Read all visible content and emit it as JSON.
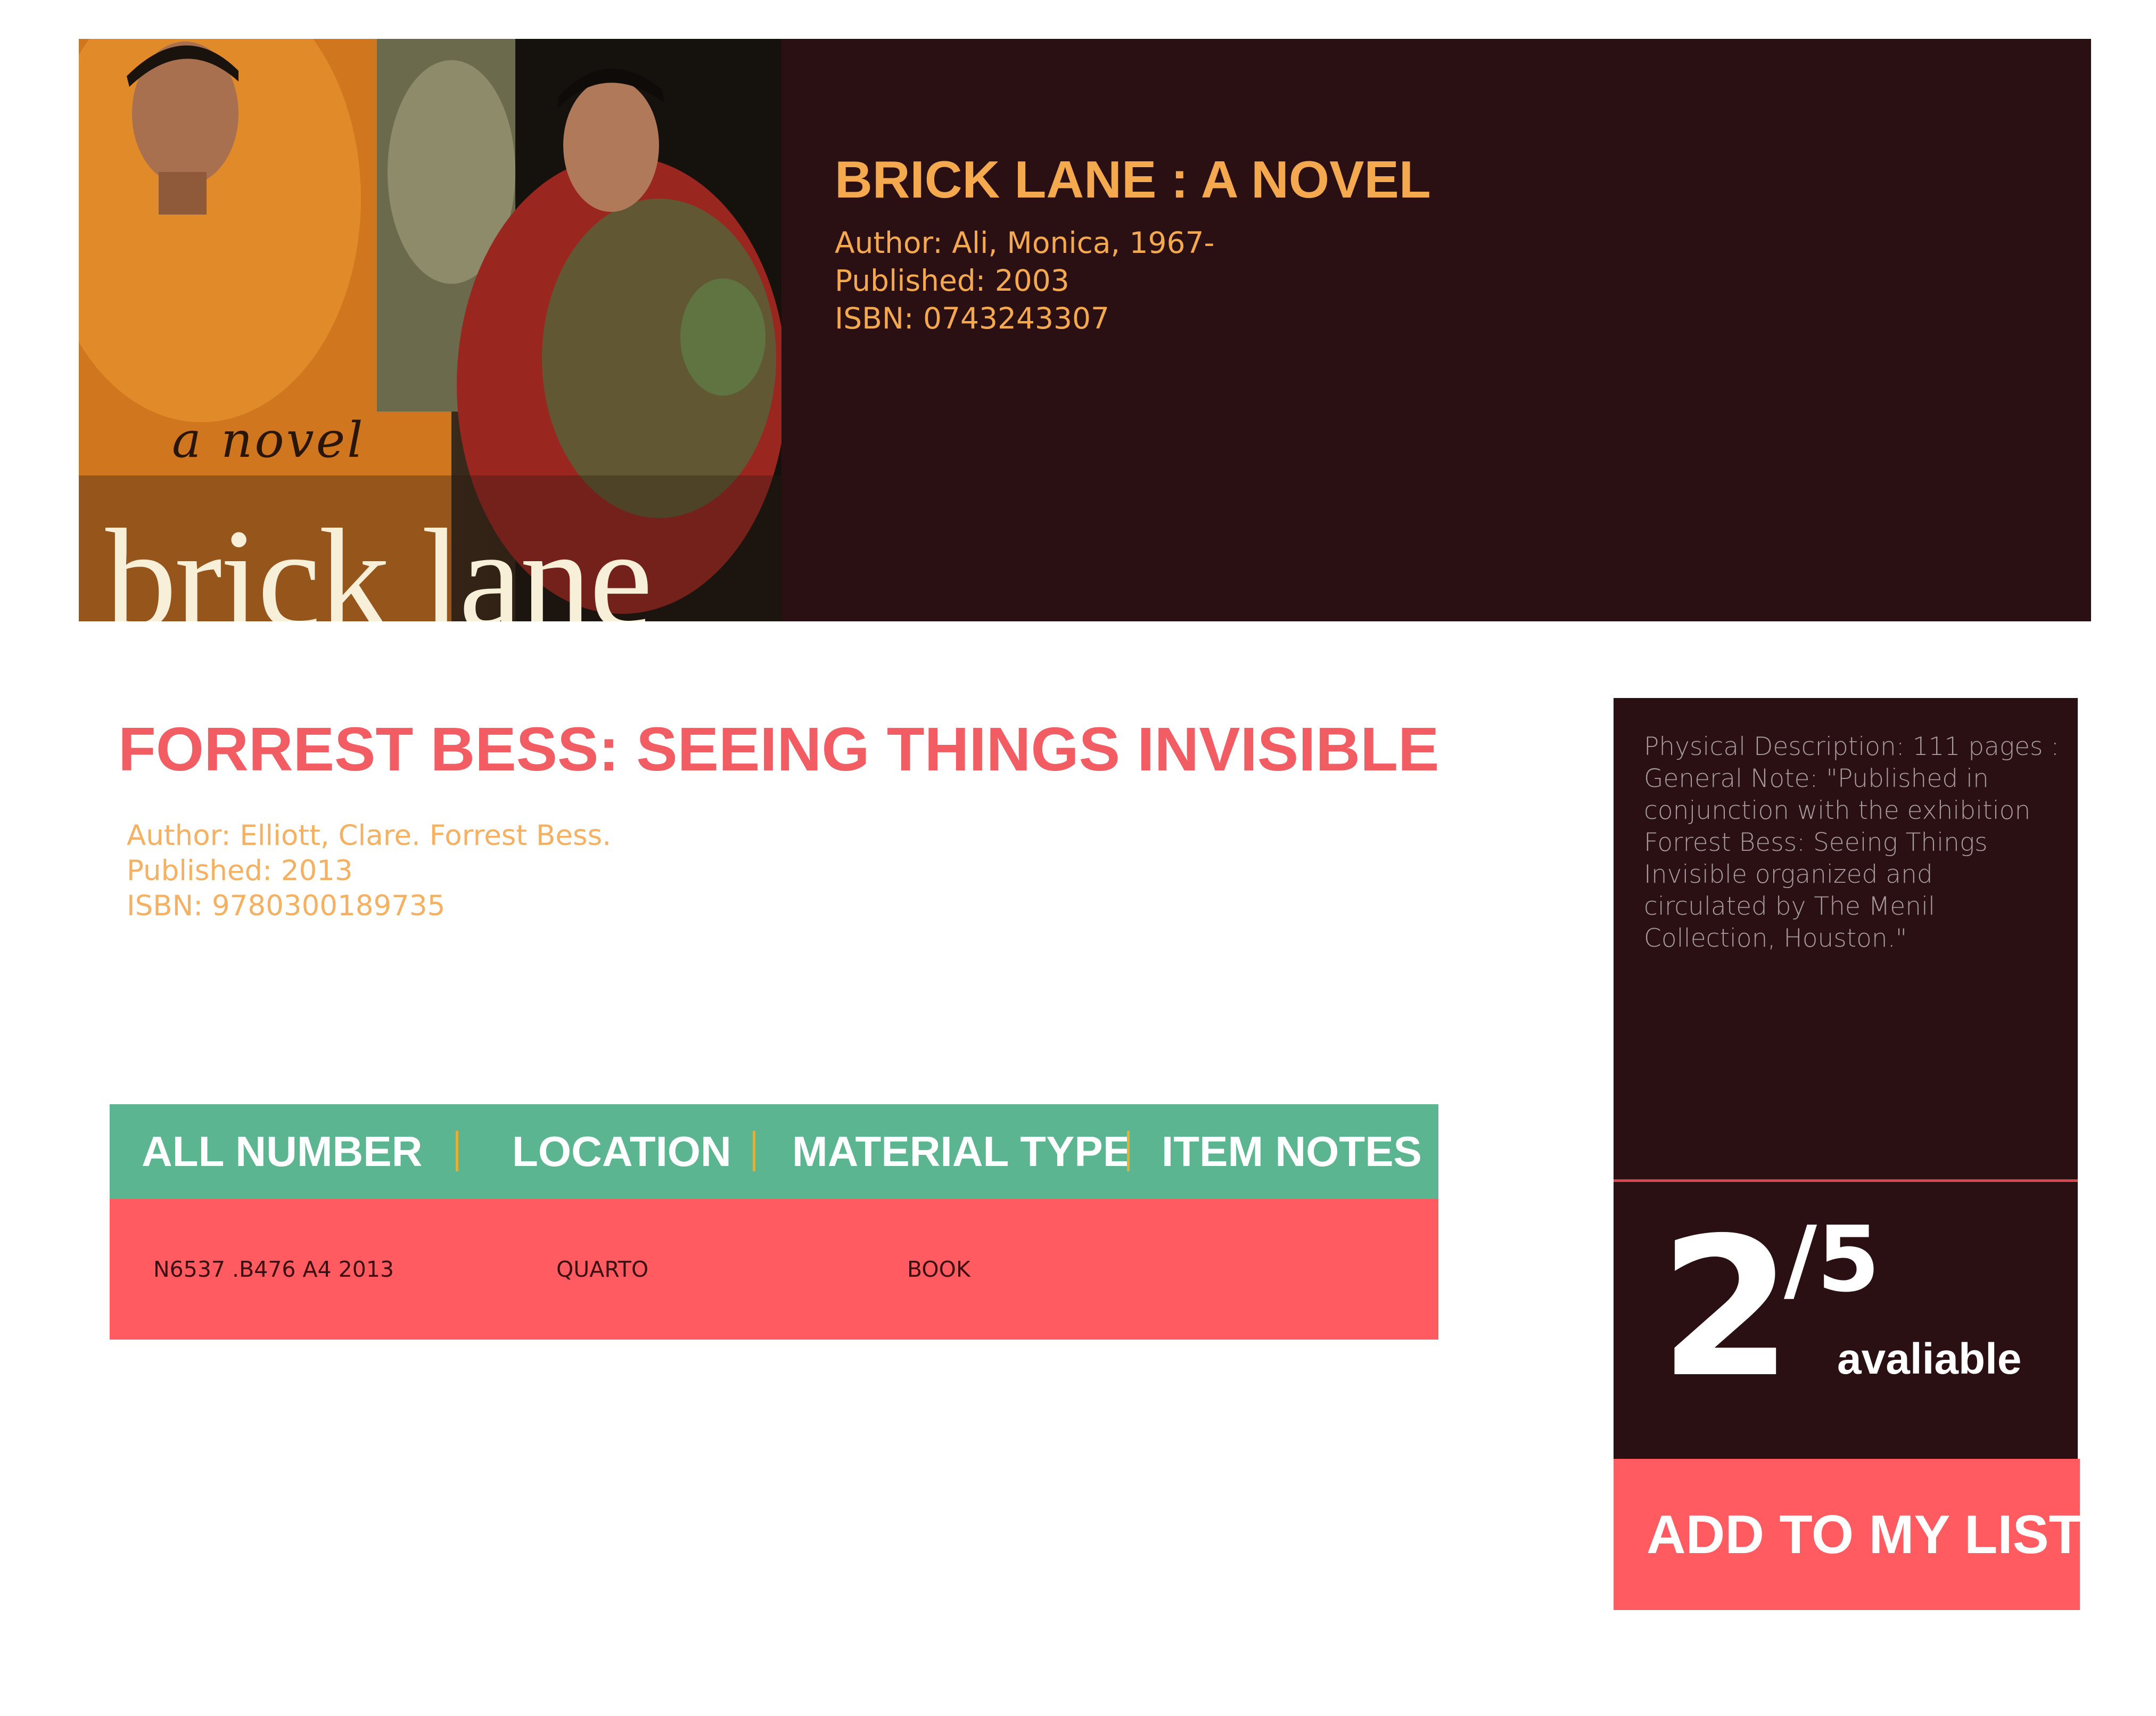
{
  "featured": {
    "cover": {
      "subtitle": "a novel",
      "title": "brick lane"
    },
    "title": "BRICK LANE : A NOVEL",
    "author": "Author: Ali, Monica, 1967-",
    "published": "Published: 2003",
    "isbn": "ISBN: 0743243307"
  },
  "record": {
    "title": "FORREST BESS: SEEING THINGS INVISIBLE",
    "author": "Author: Elliott, Clare. Forrest Bess.",
    "published": "Published: 2013",
    "isbn": "ISBN: 9780300189735"
  },
  "holdings": {
    "columns": [
      "ALL NUMBER",
      "LOCATION",
      "MATERIAL TYPE",
      "ITEM NOTES"
    ],
    "rows": [
      {
        "call_number": "N6537 .B476 A4 2013",
        "location": "QUARTO",
        "material_type": "BOOK",
        "item_notes": ""
      }
    ]
  },
  "details": {
    "lines": [
      "Physical Description: 111 pages :",
      "General Note: \"Published in",
      "conjunction with the exhibition",
      "Forrest Bess: Seeing Things",
      "Invisible organized and",
      "circulated by The Menil",
      "Collection, Houston.\""
    ]
  },
  "availability": {
    "available": "2",
    "total": "/5",
    "label": "avaliable"
  },
  "actions": {
    "add_label": "ADD TO MY LIST"
  },
  "colors": {
    "dark_panel": "#2a1012",
    "accent_orange": "#f5a94e",
    "accent_red": "#ff5b61",
    "title_red": "#f25c63",
    "header_green": "#5bb590",
    "separator_gold": "#e0b13a"
  }
}
